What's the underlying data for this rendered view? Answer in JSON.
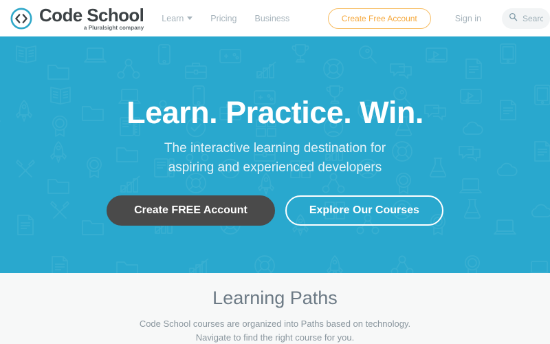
{
  "brand": {
    "name": "Code School",
    "tagline": "a Pluralsight company",
    "logo_icon": "code-brackets-circle-icon",
    "logo_color": "#2fa8c9"
  },
  "header": {
    "nav": [
      {
        "label": "Learn",
        "has_dropdown": true,
        "icon": "chevron-down-icon"
      },
      {
        "label": "Pricing",
        "has_dropdown": false
      },
      {
        "label": "Business",
        "has_dropdown": false
      }
    ],
    "cta_label": "Create Free Account",
    "cta_color": "#f5a83c",
    "signin_label": "Sign in",
    "search": {
      "icon": "search-icon",
      "value": "",
      "placeholder": "Search"
    }
  },
  "hero": {
    "title": "Learn. Practice. Win.",
    "subtitle_line1": "The interactive learning destination for",
    "subtitle_line2": "aspiring and experienced developers",
    "primary_cta": "Create FREE Account",
    "secondary_cta": "Explore Our Courses",
    "background_color": "#29a8ce",
    "pattern_icons": [
      "book-icon",
      "laptop-icon",
      "smartphone-icon",
      "gamepad-icon",
      "trophy-icon",
      "magnifier-icon",
      "video-player-icon",
      "tablet-icon",
      "rocket-icon",
      "folder-icon",
      "network-icon",
      "briefcase-icon",
      "bar-chart-icon",
      "life-ring-icon",
      "speech-bubbles-icon",
      "document-icon",
      "hammers-icon",
      "badge-icon",
      "ruler-icon",
      "checkmark-circle-icon",
      "grid-layout-icon",
      "user-avatar-icon",
      "flask-icon",
      "cloud-icon",
      "code-tag-icon",
      "image-icon",
      "typography-icon",
      "compass-icon"
    ]
  },
  "paths": {
    "title": "Learning Paths",
    "description": "Code School courses are organized into Paths based on technology. Navigate to find the right course for you.",
    "background_color": "#f7f8f8"
  }
}
